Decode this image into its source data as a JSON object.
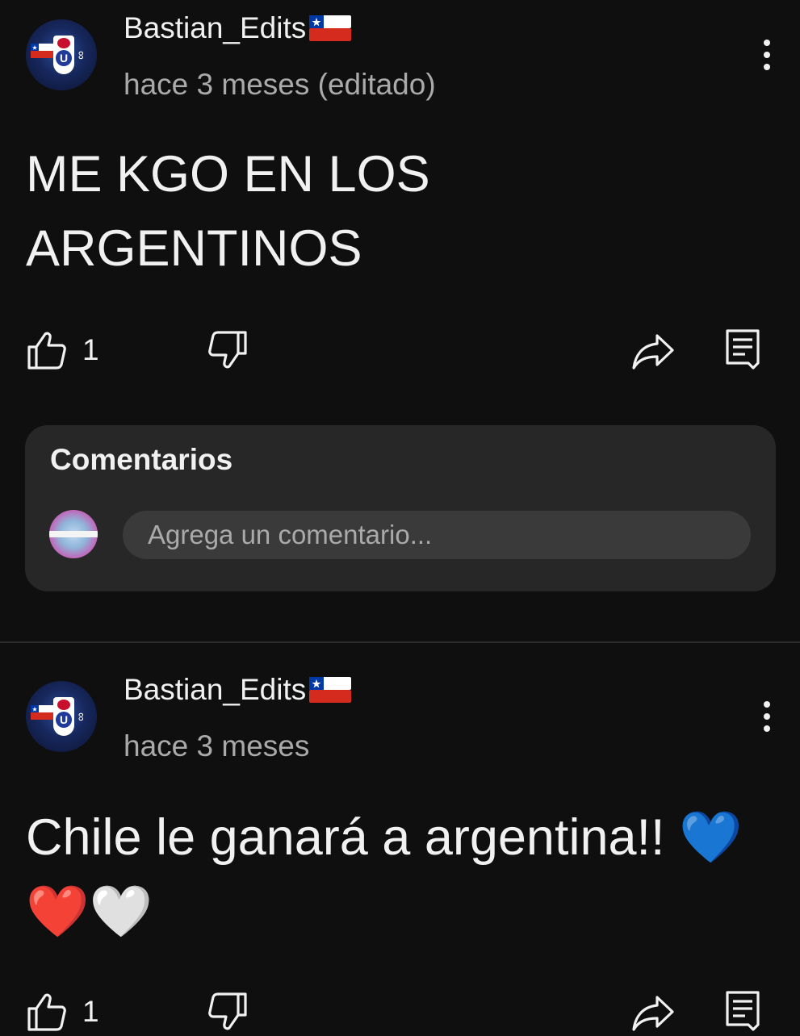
{
  "posts": [
    {
      "author": "Bastian_Edits",
      "author_flag_icon": "chile-flag-icon",
      "timestamp": "hace 3 meses (editado)",
      "text": "ME KGO EN LOS ARGENTINOS",
      "like_count": "1"
    },
    {
      "author": "Bastian_Edits",
      "author_flag_icon": "chile-flag-icon",
      "timestamp": "hace 3 meses",
      "text": "Chile le ganará a argentina!!",
      "text_emoji": "💙❤️🤍",
      "like_count": "1"
    }
  ],
  "comments": {
    "title": "Comentarios",
    "placeholder": "Agrega un comentario..."
  },
  "colors": {
    "background": "#0f0f0f",
    "panel": "#272727",
    "text": "#f1f1f1",
    "secondary_text": "#aaaaaa"
  }
}
